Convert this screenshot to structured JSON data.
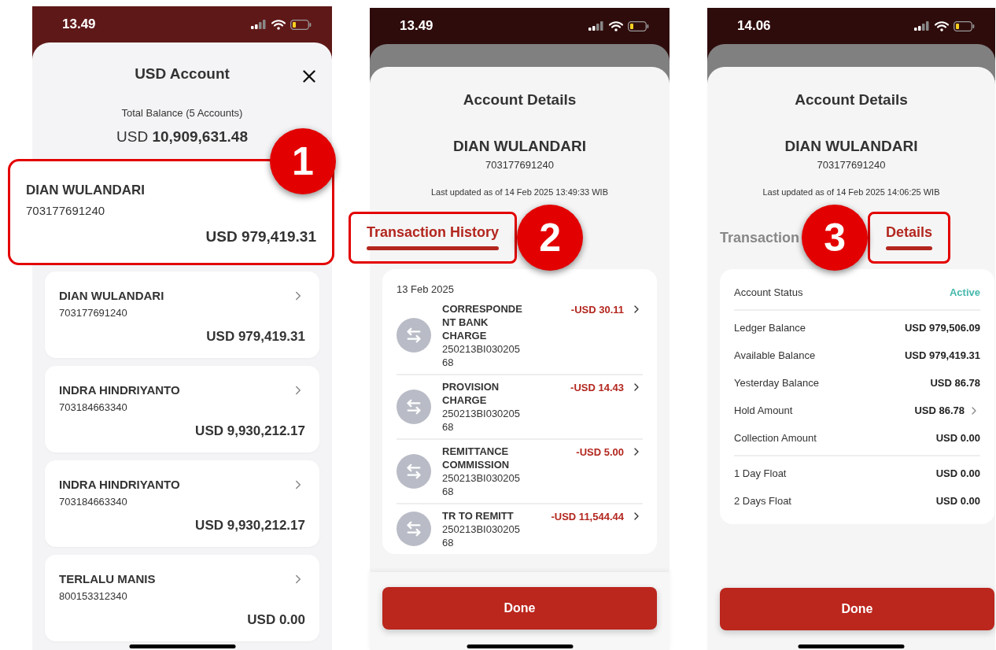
{
  "phones": [
    {
      "kind": "account_list",
      "time": "13.49",
      "title": "USD Account",
      "total_label": "Total Balance (5 Accounts)",
      "total": "USD **10,909,631.48**",
      "highlight": {
        "name": "DIAN WULANDARI",
        "number": "703177691240",
        "amount": "USD 979,419.31",
        "step": "1"
      },
      "accounts": [
        {
          "name": "DIAN WULANDARI",
          "number": "703177691240",
          "amount": "USD 979,419.31"
        },
        {
          "name": "INDRA HINDRIYANTO",
          "number": "703184663340",
          "amount": "USD 9,930,212.17"
        },
        {
          "name": "INDRA HINDRIYANTO",
          "number": "703184663340",
          "amount": "USD 9,930,212.17"
        },
        {
          "name": "TERLALU MANIS",
          "number": "800153312340",
          "amount": "USD 0.00"
        }
      ]
    },
    {
      "kind": "transactions",
      "time": "13.49",
      "title": "Account Details",
      "name": "DIAN WULANDARI",
      "number": "703177691240",
      "updated": "Last updated as of 14 Feb 2025 13:49:33 WIB",
      "step": "2",
      "tabs": [
        {
          "label": "Transaction History",
          "selected": true,
          "highlighted": true
        }
      ],
      "date": "13 Feb 2025",
      "transactions": [
        {
          "title": "CORRESPONDENT BANK CHARGE",
          "reference": "250213BI03020568",
          "amount": "-USD 30.11"
        },
        {
          "title": "PROVISION CHARGE",
          "reference": "250213BI03020568",
          "amount": "-USD 14.43"
        },
        {
          "title": "REMITTANCE COMMISSION",
          "reference": "250213BI03020568",
          "amount": "-USD 5.00"
        },
        {
          "title": "TR TO REMITT",
          "reference": "250213BI03020568",
          "amount": "-USD 11,544.44"
        }
      ],
      "button": "Done"
    },
    {
      "kind": "details",
      "time": "14.06",
      "title": "Account Details",
      "name": "DIAN WULANDARI",
      "number": "703177691240",
      "updated": "Last updated as of 14 Feb 2025 14:06:25 WIB",
      "step": "3",
      "tabs": [
        {
          "label": "Transaction",
          "selected": false,
          "highlighted": false
        },
        {
          "label": "Details",
          "selected": true,
          "highlighted": true
        }
      ],
      "sections": [
        {
          "rows": [
            {
              "kind": "status",
              "label": "Account Status",
              "value": "Active",
              "chevron": false
            }
          ]
        },
        {
          "rows": [
            {
              "kind": "amount",
              "label": "Ledger Balance",
              "value": "USD 979,506.09",
              "chevron": false
            },
            {
              "kind": "amount",
              "label": "Available Balance",
              "value": "USD 979,419.31",
              "chevron": false
            },
            {
              "kind": "amount",
              "label": "Yesterday Balance",
              "value": "USD 86.78",
              "chevron": false
            },
            {
              "kind": "amount",
              "label": "Hold Amount",
              "value": "USD 86.78",
              "chevron": true
            },
            {
              "kind": "amount",
              "label": "Collection Amount",
              "value": "USD 0.00",
              "chevron": false
            }
          ]
        },
        {
          "rows": [
            {
              "kind": "amount",
              "label": "1 Day Float",
              "value": "USD 0.00",
              "chevron": false
            },
            {
              "kind": "amount",
              "label": "2 Days Float",
              "value": "USD 0.00",
              "chevron": false
            }
          ]
        }
      ],
      "button": "Done"
    }
  ]
}
